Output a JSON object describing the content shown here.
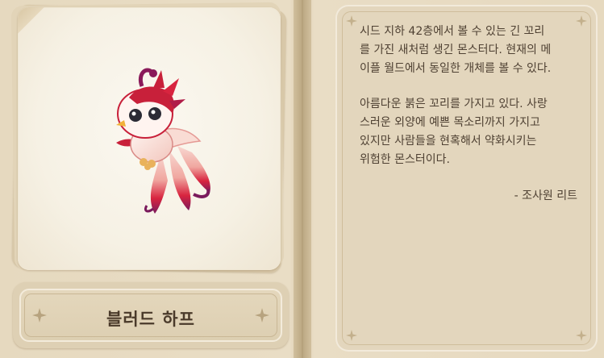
{
  "monster": {
    "name": "블러드 하프",
    "description": [
      "시드 지하 42층에서 볼 수 있는 긴 꼬리\n를 가진 새처럼 생긴 몬스터다. 현재의 메\n이플 월드에서 동일한 개체를 볼 수 있다.",
      "아름다운 붉은 꼬리를 가지고 있다. 사랑\n스러운 외양에 예쁜 목소리까지 가지고\n있지만 사람들을 현혹해서 약화시키는\n위험한 몬스터이다."
    ],
    "signature": "- 조사원 리트",
    "image_icon": "blood-harp-monster"
  },
  "colors": {
    "page_bg": "#e8dcc3",
    "card_bg": "#f6f1e4",
    "text": "#4f4133",
    "name_text": "#4a3a2a",
    "accent_red": "#c8203a"
  }
}
